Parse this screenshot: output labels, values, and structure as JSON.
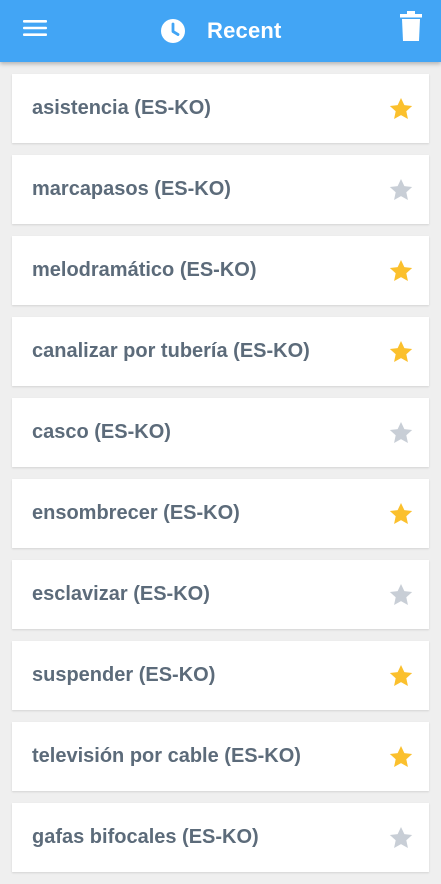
{
  "header": {
    "title": "Recent",
    "menu_icon": "hamburger-menu-icon",
    "title_icon": "clock-icon",
    "delete_icon": "trash-icon",
    "background_color": "#42a5f5"
  },
  "colors": {
    "star_active": "#fbc02d",
    "star_inactive": "#c8ced6",
    "item_text": "#5c6b7a"
  },
  "items": [
    {
      "label": "asistencia (ES-KO)",
      "starred": true
    },
    {
      "label": "marcapasos (ES-KO)",
      "starred": false
    },
    {
      "label": "melodramático (ES-KO)",
      "starred": true
    },
    {
      "label": "canalizar por tubería (ES-KO)",
      "starred": true
    },
    {
      "label": "casco (ES-KO)",
      "starred": false
    },
    {
      "label": "ensombrecer (ES-KO)",
      "starred": true
    },
    {
      "label": "esclavizar (ES-KO)",
      "starred": false
    },
    {
      "label": "suspender (ES-KO)",
      "starred": true
    },
    {
      "label": "televisión por cable (ES-KO)",
      "starred": true
    },
    {
      "label": "gafas bifocales (ES-KO)",
      "starred": false
    }
  ]
}
